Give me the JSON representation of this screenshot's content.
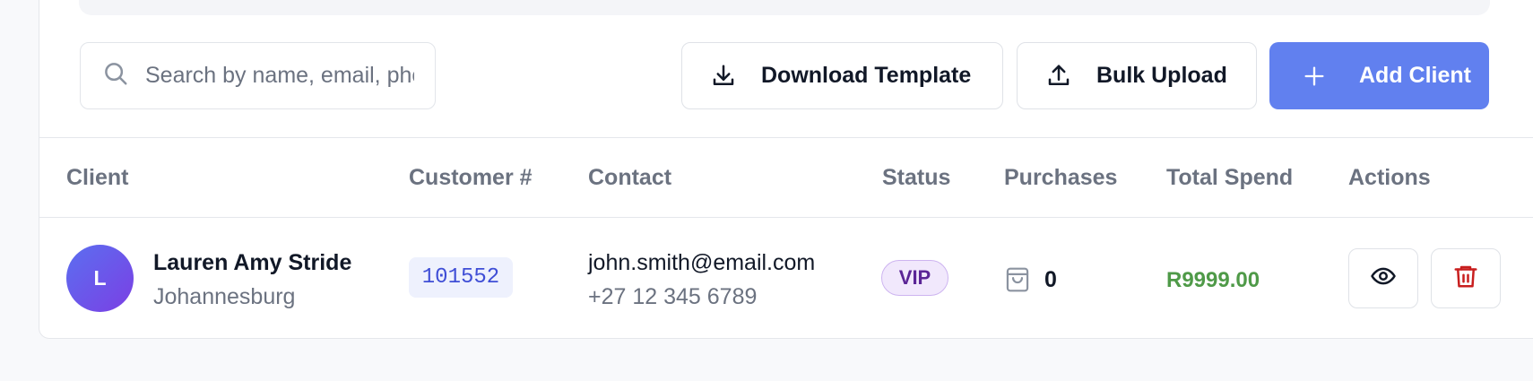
{
  "toolbar": {
    "search_placeholder": "Search by name, email, phone...",
    "download_label": "Download Template",
    "bulk_label": "Bulk Upload",
    "add_label": "Add Client"
  },
  "table": {
    "headers": [
      "Client",
      "Customer #",
      "Contact",
      "Status",
      "Purchases",
      "Total Spend",
      "Actions"
    ],
    "rows": [
      {
        "initial": "L",
        "name": "Lauren Amy Stride",
        "city": "Johannesburg",
        "customer_number": "101552",
        "email": "john.smith@email.com",
        "phone": "+27 12 345 6789",
        "status": "VIP",
        "purchases": "0",
        "total_spend": "R9999.00"
      }
    ]
  },
  "icons": {
    "search": "search-icon",
    "download": "download-icon",
    "upload": "upload-icon",
    "add": "plus-icon",
    "purchases": "shopping-bag-icon",
    "view": "eye-icon",
    "delete": "trash-icon"
  },
  "colors": {
    "primary": "#6180ef",
    "spend": "#4f9a48",
    "vip_bg": "#f1e8fc",
    "vip_text": "#5b2596",
    "delete": "#c81e1e"
  }
}
